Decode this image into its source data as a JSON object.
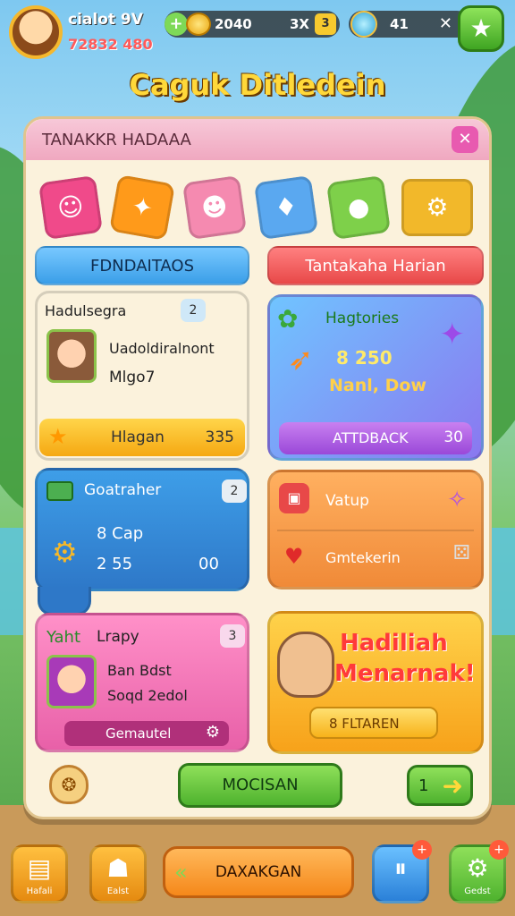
{
  "player": {
    "name": "cialot 9V",
    "sub": "72832 480"
  },
  "hud": {
    "plus": "+",
    "coins": "2040",
    "coins_extra": "3X",
    "gold_small": "3",
    "gems": "41",
    "gems_close": "✕"
  },
  "game_title": "Caguk Ditledein",
  "panel": {
    "title": "TANAKKR HADAAA",
    "close": "✕",
    "tabs": [
      "FDNDAITAOS",
      "Tantakaha Harian"
    ]
  },
  "cards": {
    "a": {
      "title": "Hadulsegra",
      "badge": "2",
      "line1": "Uadoldiralnont",
      "line2": "Mlgo7",
      "bar_label": "Hlagan",
      "bar_value": "335"
    },
    "b": {
      "title": "Hagtories",
      "value": "8 250",
      "sub": "Nanl, Dow",
      "btn_label": "ATTDBACK",
      "btn_value": "30"
    },
    "c": {
      "title": "Goatraher",
      "badge": "2",
      "line1": "8 Cap",
      "line2": "2 55",
      "line3": "00"
    },
    "d": {
      "line1": "Vatup",
      "line2": "Gmtekerin"
    },
    "e": {
      "head_icon": "Yaht",
      "title": "Lrapy",
      "badge": "3",
      "line1": "Ban Bdst",
      "line2": "Soqd 2edol",
      "bar_label": "Gemautel"
    },
    "f": {
      "promo_line1": "Hadiliah",
      "promo_line2": "Menarnak!",
      "btn_label": "8 FLTAREN"
    }
  },
  "actions": {
    "main_button": "MOCISAN",
    "next_num": "1"
  },
  "bottom_nav": {
    "left1_label": "Hafali",
    "left2_label": "Ealst",
    "center_label": "DAXAKGAN",
    "right1_label": "",
    "right2_label": "Gedst",
    "notif1": "+",
    "notif2": "+"
  }
}
